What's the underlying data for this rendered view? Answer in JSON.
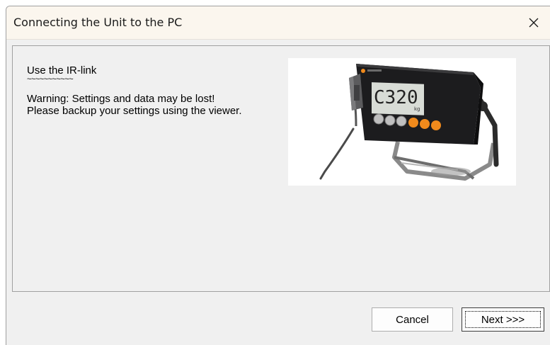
{
  "window": {
    "title": "Connecting the Unit to the PC"
  },
  "titlebar": {
    "close_icon": "close-icon"
  },
  "content": {
    "heading": "Use the IR-link",
    "underline": "~~~~~~~~~~~",
    "warning_line1": "Warning: Settings and data may be lost!",
    "warning_line2": "Please backup your settings using the viewer.",
    "device_display_text": "C320",
    "device_unit_text": "kg"
  },
  "buttons": {
    "cancel_label": "Cancel",
    "next_label": "Next >>>"
  },
  "colors": {
    "window_bg": "#f0f0f0",
    "titlebar_bg": "#fbf6ee",
    "device_body": "#1c1c1e",
    "device_orange_key": "#f08a1c",
    "device_grey_key": "#bfbfbf"
  }
}
